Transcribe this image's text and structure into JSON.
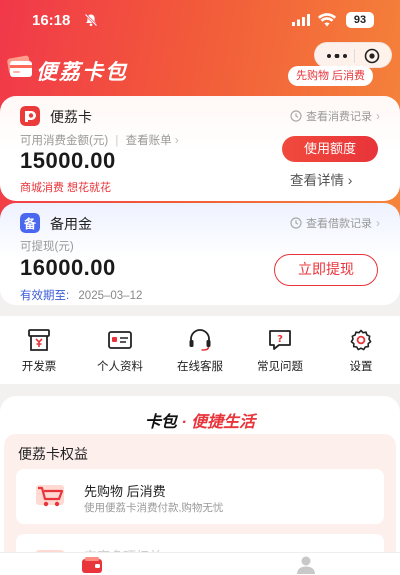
{
  "status_bar": {
    "time": "16:18",
    "battery": "93"
  },
  "header": {
    "app_title": "便荔卡包",
    "promo_tag": "先购物 后消费"
  },
  "card1": {
    "name": "便荔卡",
    "record_link": "查看消费记录",
    "sub_label": "可用消费金额(元)",
    "bill_link": "查看账单",
    "amount": "15000.00",
    "tagline": "商城消费 想花就花",
    "action_button": "使用额度",
    "detail_link": "查看详情"
  },
  "card2": {
    "name": "备用金",
    "record_link": "查看借款记录",
    "sub_label": "可提现(元)",
    "amount": "16000.00",
    "validity_label": "有效期至:",
    "validity_date": "2025–03–12",
    "action_button": "立即提现"
  },
  "menu": {
    "items": [
      {
        "label": "开发票",
        "icon": "invoice-icon"
      },
      {
        "label": "个人资料",
        "icon": "profile-card-icon"
      },
      {
        "label": "在线客服",
        "icon": "headset-icon"
      },
      {
        "label": "常见问题",
        "icon": "faq-icon"
      },
      {
        "label": "设置",
        "icon": "gear-icon"
      }
    ]
  },
  "slogan": {
    "part1": "卡包",
    "dot": "·",
    "part2": "便捷生活"
  },
  "benefits": {
    "title": "便荔卡权益",
    "items": [
      {
        "title": "先购物 后消费",
        "desc": "使用便荔卡消费付款,购物无忧"
      },
      {
        "title": "安享多项权益",
        "desc": ""
      }
    ]
  },
  "tabbar": {
    "items": [
      {
        "icon": "wallet-icon"
      },
      {
        "icon": "user-icon"
      }
    ]
  },
  "colors": {
    "accent": "#e8343a",
    "hero_start": "#f1384a",
    "hero_end": "#f5853a"
  }
}
